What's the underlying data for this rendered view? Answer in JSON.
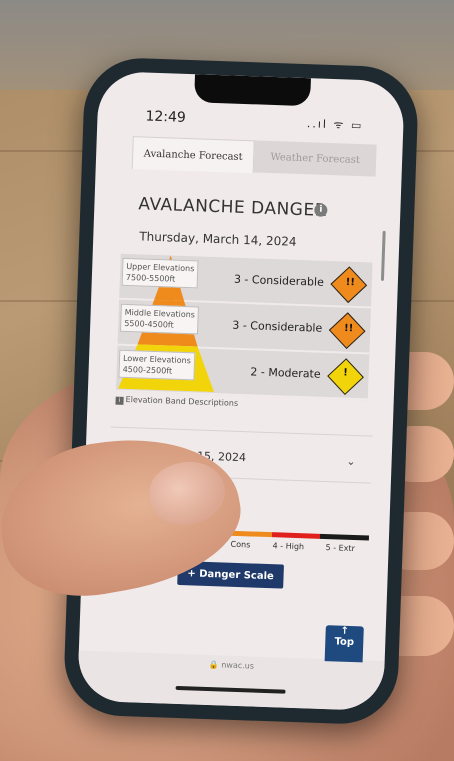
{
  "status": {
    "time": "12:49",
    "icons": "..ıl ᯤ ▭"
  },
  "tabs": [
    {
      "label": "Avalanche Forecast"
    },
    {
      "label": "Weather Forecast"
    }
  ],
  "section": {
    "title": "AVALANCHE DANGER",
    "info_icon": "i"
  },
  "forecast_day1": {
    "date": "Thursday, March 14, 2024",
    "bands": [
      {
        "name": "Upper Elevations",
        "range": "7500-5500ft",
        "rating": "3 - Considerable",
        "level": 3,
        "color": "#ef8a1c"
      },
      {
        "name": "Middle Elevations",
        "range": "5500-4500ft",
        "rating": "3 - Considerable",
        "level": 3,
        "color": "#ef8a1c"
      },
      {
        "name": "Lower Elevations",
        "range": "4500-2500ft",
        "rating": "2 - Moderate",
        "level": 2,
        "color": "#f2d40a"
      }
    ],
    "band_desc_link": "Elevation Band Descriptions"
  },
  "forecast_day2": {
    "date": "Friday, March 15, 2024",
    "chevron": "⌄"
  },
  "scale": {
    "labels": [
      "Cons",
      "4 - High",
      "5 - Extr"
    ],
    "colors": [
      "#ef8a1c",
      "#e0201c",
      "#1a1a1a"
    ]
  },
  "buttons": {
    "danger_scale": "+ Danger Scale",
    "top_arrow": "↑",
    "top": "Top"
  },
  "browser": {
    "url": "🔒 nwac.us"
  }
}
